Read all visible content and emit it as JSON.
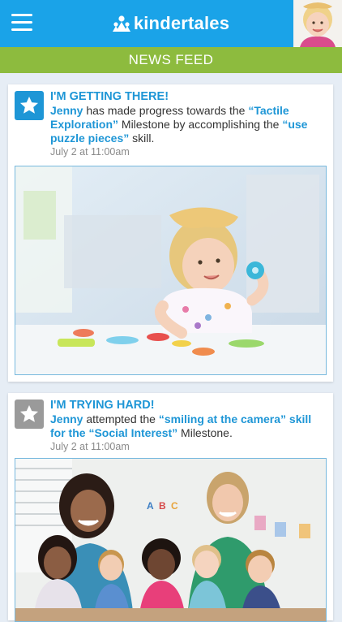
{
  "app": {
    "logo_text": "kindertales",
    "page_title": "NEWS FEED"
  },
  "colors": {
    "topbar": "#1aa3e8",
    "subbar": "#8dbb3e",
    "accent_text": "#1e96d6",
    "badge_gray": "#9a9a9a"
  },
  "posts": [
    {
      "status_icon": "star-icon",
      "status_color": "#1e96d6",
      "title": "I'M GETTING THERE!",
      "child": "Jenny",
      "text_1": " has made progress towards the ",
      "milestone": "“Tactile Exploration”",
      "text_2": " Milestone by accomplishing the ",
      "skill": "“use puzzle pieces”",
      "text_3": " skill.",
      "time": "July 2 at 11:00am"
    },
    {
      "status_icon": "star-icon",
      "status_color": "#9a9a9a",
      "title": "I'M TRYING HARD!",
      "child": "Jenny",
      "text_1": " attempted the ",
      "skill": "“smiling at the camera” skill for the “Social Interest”",
      "text_2": " Milestone.",
      "time": "July 2 at 11:00am"
    }
  ]
}
